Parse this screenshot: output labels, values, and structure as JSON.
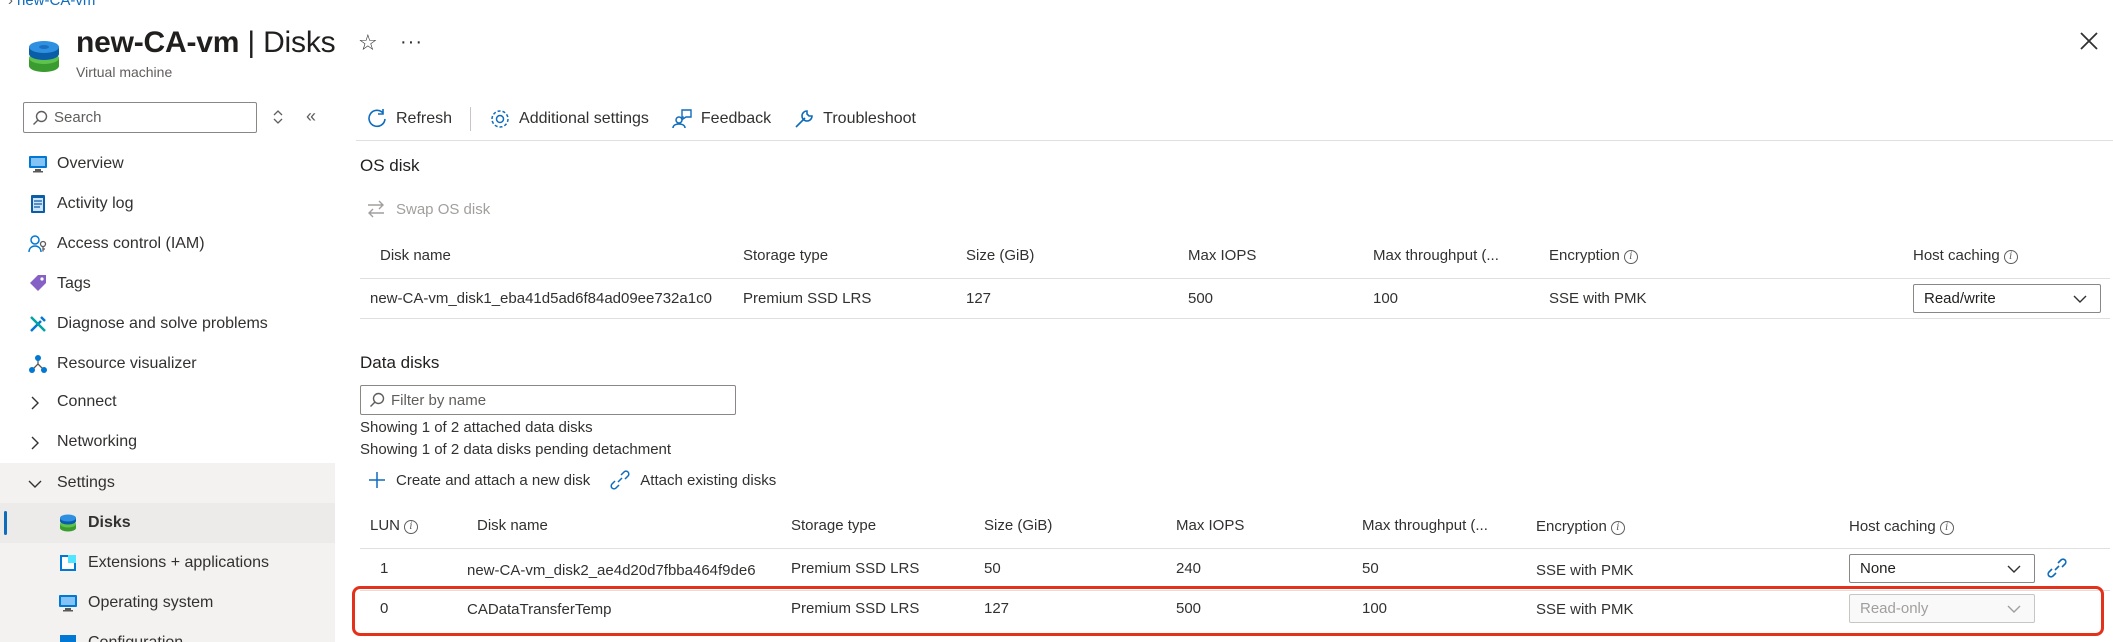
{
  "breadcrumb": {
    "item": "new-CA-vm"
  },
  "header": {
    "title_name": "new-CA-vm",
    "title_sep": "|",
    "title_page": "Disks",
    "subtitle": "Virtual machine",
    "more_label": "···"
  },
  "sidebar": {
    "search_placeholder": "Search",
    "items": [
      {
        "label": "Overview",
        "icon": "overview-icon"
      },
      {
        "label": "Activity log",
        "icon": "activity-log-icon"
      },
      {
        "label": "Access control (IAM)",
        "icon": "iam-icon"
      },
      {
        "label": "Tags",
        "icon": "tag-icon"
      },
      {
        "label": "Diagnose and solve problems",
        "icon": "diagnose-icon"
      },
      {
        "label": "Resource visualizer",
        "icon": "resource-visualizer-icon"
      },
      {
        "label": "Connect",
        "icon": "chevron-right-icon"
      },
      {
        "label": "Networking",
        "icon": "chevron-right-icon"
      },
      {
        "label": "Settings",
        "icon": "chevron-down-icon"
      },
      {
        "label": "Disks",
        "icon": "disk-icon"
      },
      {
        "label": "Extensions + applications",
        "icon": "extensions-icon"
      },
      {
        "label": "Operating system",
        "icon": "monitor-icon"
      },
      {
        "label": "Configuration",
        "icon": "configuration-icon"
      }
    ]
  },
  "toolbar": {
    "refresh": "Refresh",
    "additional_settings": "Additional settings",
    "feedback": "Feedback",
    "troubleshoot": "Troubleshoot"
  },
  "os_disk": {
    "section_title": "OS disk",
    "swap_label": "Swap OS disk",
    "columns": [
      "Disk name",
      "Storage type",
      "Size (GiB)",
      "Max IOPS",
      "Max throughput (...",
      "Encryption",
      "Host caching"
    ],
    "row": {
      "disk_name": "new-CA-vm_disk1_eba41d5ad6f84ad09ee732a1c0",
      "storage_type": "Premium SSD LRS",
      "size": "127",
      "max_iops": "500",
      "max_throughput": "100",
      "encryption": "SSE with PMK",
      "host_caching": "Read/write"
    }
  },
  "data_disks": {
    "section_title": "Data disks",
    "filter_placeholder": "Filter by name",
    "info_attached": "Showing 1 of 2 attached data disks",
    "info_pending": "Showing 1 of 2 data disks pending detachment",
    "create_attach": "Create and attach a new disk",
    "attach_existing": "Attach existing disks",
    "columns": [
      "LUN",
      "Disk name",
      "Storage type",
      "Size (GiB)",
      "Max IOPS",
      "Max throughput (...",
      "Encryption",
      "Host caching"
    ],
    "rows": [
      {
        "lun": "1",
        "disk_name": "new-CA-vm_disk2_ae4d20d7fbba464f9de6",
        "storage_type": "Premium SSD LRS",
        "size": "50",
        "max_iops": "240",
        "max_throughput": "50",
        "encryption": "SSE with PMK",
        "host_caching": "None"
      },
      {
        "lun": "0",
        "disk_name": "CADataTransferTemp",
        "storage_type": "Premium SSD LRS",
        "size": "127",
        "max_iops": "500",
        "max_throughput": "100",
        "encryption": "SSE with PMK",
        "host_caching": "Read-only"
      }
    ]
  },
  "colors": {
    "accent": "#0f6cbd",
    "highlight": "#e3311b"
  }
}
